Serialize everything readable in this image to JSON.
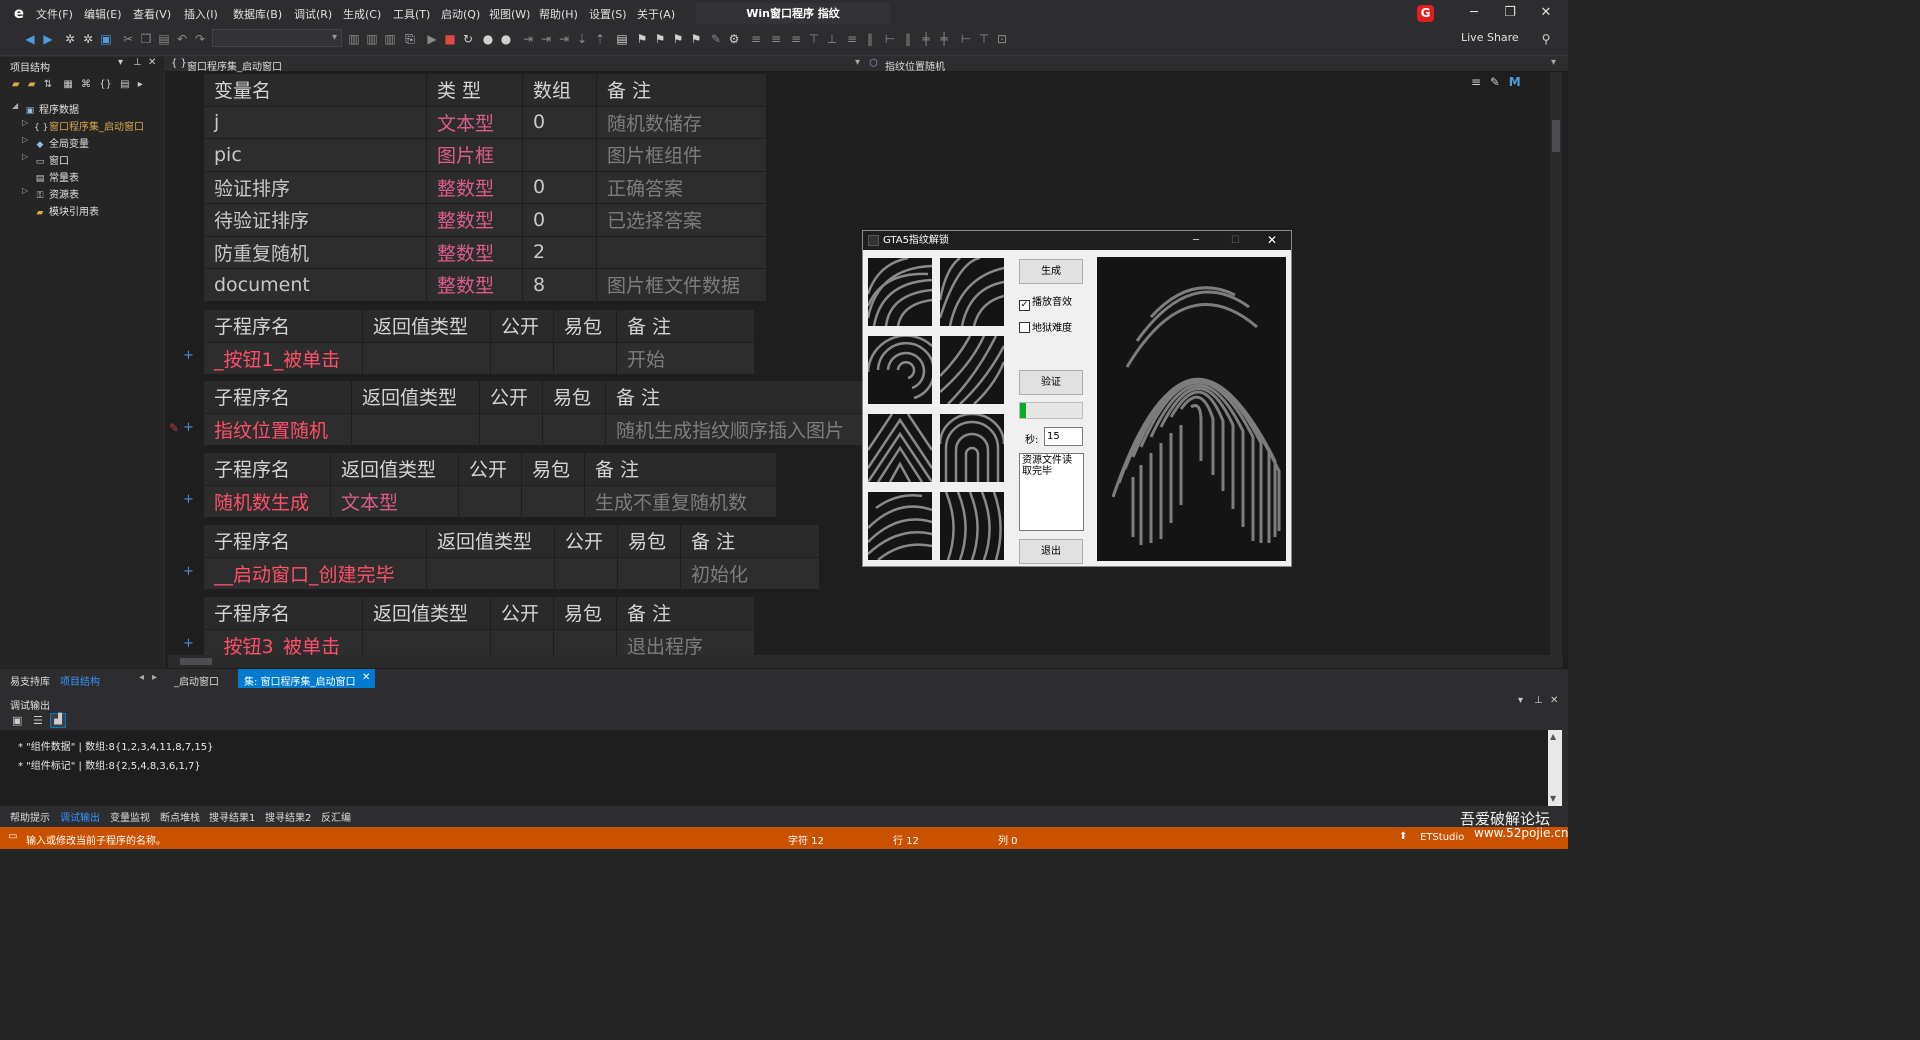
{
  "app": {
    "title": "Win窗口程序 指纹",
    "logo": "e",
    "badge": "G",
    "live_share": "Live Share"
  },
  "menu": [
    "文件(F)",
    "编辑(E)",
    "查看(V)",
    "插入(I)",
    "数据库(B)",
    "调试(R)",
    "生成(C)",
    "工具(T)",
    "启动(Q)",
    "视图(W)",
    "帮助(H)",
    "设置(S)",
    "关于(A)"
  ],
  "window_controls": {
    "minimize": "─",
    "restore": "❐",
    "close": "✕"
  },
  "left_panel": {
    "title": "项目结构",
    "root": "程序数据",
    "items": [
      {
        "label": "窗口程序集_启动窗口",
        "icon": "braces-icon",
        "highlight": true
      },
      {
        "label": "全局变量",
        "icon": "globe-icon"
      },
      {
        "label": "窗口",
        "icon": "window-icon"
      },
      {
        "label": "常量表",
        "icon": "table-icon"
      },
      {
        "label": "资源表",
        "icon": "resource-icon"
      },
      {
        "label": "模块引用表",
        "icon": "module-icon"
      }
    ]
  },
  "editor": {
    "breadcrumb_left": "窗口程序集_启动窗口",
    "breadcrumb_right": "指纹位置随机",
    "var_table": {
      "headers": [
        "变量名",
        "类 型",
        "数组",
        "备 注"
      ],
      "rows": [
        [
          "j",
          "文本型",
          "0",
          "随机数储存"
        ],
        [
          "pic",
          "图片框",
          "",
          "图片框组件"
        ],
        [
          "验证排序",
          "整数型",
          "0",
          "正确答案"
        ],
        [
          "待验证排序",
          "整数型",
          "0",
          "已选择答案"
        ],
        [
          "防重复随机",
          "整数型",
          "2",
          ""
        ],
        [
          "document",
          "整数型",
          "8",
          "图片框文件数据"
        ]
      ]
    },
    "sub_headers": [
      "子程序名",
      "返回值类型",
      "公开",
      "易包",
      "备 注"
    ],
    "subs": [
      {
        "name": "_按钮1_被单击",
        "ret": "",
        "comment": "开始"
      },
      {
        "name": "指纹位置随机",
        "ret": "",
        "comment": "随机生成指纹顺序插入图片"
      },
      {
        "name": "随机数生成",
        "ret": "文本型",
        "comment": "生成不重复随机数"
      },
      {
        "name": "__启动窗口_创建完毕",
        "ret": "",
        "comment": "初始化"
      },
      {
        "name": "_按钮3_被单击",
        "ret": "",
        "comment": "退出程序"
      }
    ],
    "plus": "+"
  },
  "gta_window": {
    "title": "GTA5指纹解锁",
    "btn_generate": "生成",
    "chk_sound": "播放音效",
    "chk_hell": "地狱难度",
    "btn_verify": "验证",
    "seconds_label": "秒:",
    "seconds_value": "15",
    "log_text": "资源文件读取完毕",
    "btn_exit": "退出",
    "sound_checked": true,
    "hell_checked": false
  },
  "bottom_tabs": {
    "left": [
      "易支持库",
      "项目结构"
    ],
    "docs": [
      "_启动窗口",
      "集: 窗口程序集_启动窗口"
    ]
  },
  "output": {
    "title": "调试输出",
    "lines": [
      "* \"组件数据\" | 数组:8{1,2,3,4,11,8,7,15}",
      "* \"组件标记\" | 数组:8{2,5,4,8,3,6,1,7}"
    ]
  },
  "tool_tabs": [
    "帮助提示",
    "调试输出",
    "变量监视",
    "断点堆栈",
    "搜寻结果1",
    "搜寻结果2",
    "反汇编"
  ],
  "status": {
    "message": "输入或修改当前子程序的名称。",
    "char": "字符 12",
    "row": "行 12",
    "col": "列 0",
    "brand": "ETStudio",
    "arrow": "⬆"
  },
  "watermark": {
    "line1": "吾爱破解论坛",
    "line2": "www.52pojie.cn"
  },
  "colors": {
    "accent": "#007acc",
    "status_bar": "#ca5100",
    "name_red": "#ff4f6a",
    "type_pink": "#d95c8c"
  }
}
